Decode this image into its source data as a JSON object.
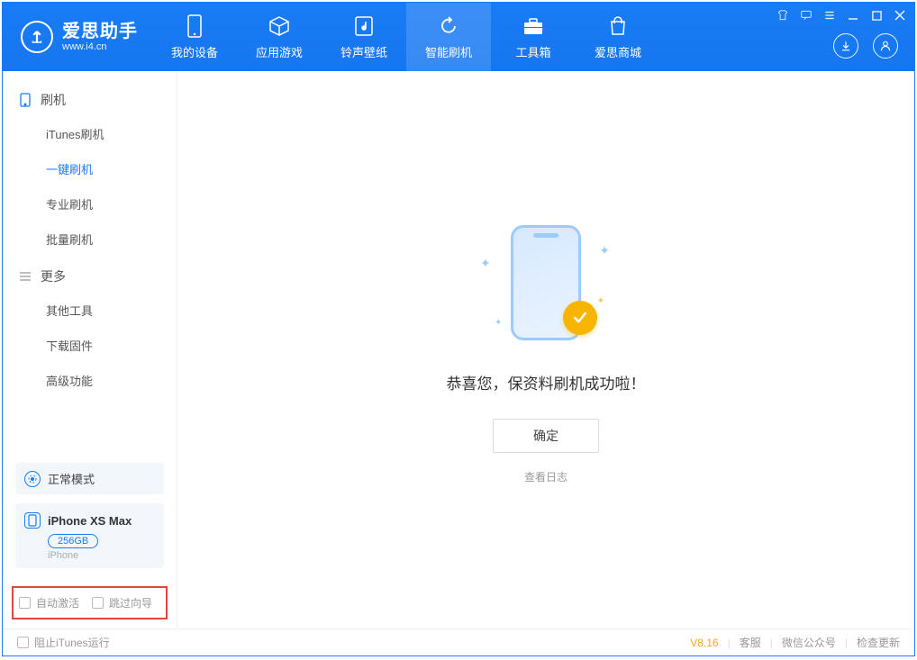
{
  "app": {
    "title": "爱思助手",
    "subtitle": "www.i4.cn"
  },
  "nav": {
    "tabs": [
      {
        "label": "我的设备",
        "icon": "device"
      },
      {
        "label": "应用游戏",
        "icon": "cube"
      },
      {
        "label": "铃声壁纸",
        "icon": "music"
      },
      {
        "label": "智能刷机",
        "icon": "refresh",
        "active": true
      },
      {
        "label": "工具箱",
        "icon": "toolbox"
      },
      {
        "label": "爱思商城",
        "icon": "shop"
      }
    ]
  },
  "sidebar": {
    "sections": [
      {
        "title": "刷机",
        "icon": "phone",
        "items": [
          {
            "label": "iTunes刷机"
          },
          {
            "label": "一键刷机",
            "active": true
          },
          {
            "label": "专业刷机"
          },
          {
            "label": "批量刷机"
          }
        ]
      },
      {
        "title": "更多",
        "icon": "menu",
        "items": [
          {
            "label": "其他工具"
          },
          {
            "label": "下载固件"
          },
          {
            "label": "高级功能"
          }
        ]
      }
    ],
    "mode": {
      "label": "正常模式"
    },
    "device": {
      "name": "iPhone XS Max",
      "capacity": "256GB",
      "type": "iPhone"
    },
    "checks": {
      "auto_activate": "自动激活",
      "skip_guide": "跳过向导"
    }
  },
  "main": {
    "success_text": "恭喜您，保资料刷机成功啦！",
    "ok_button": "确定",
    "view_log": "查看日志"
  },
  "footer": {
    "block_itunes": "阻止iTunes运行",
    "version": "V8.16",
    "links": [
      "客服",
      "微信公众号",
      "检查更新"
    ]
  }
}
